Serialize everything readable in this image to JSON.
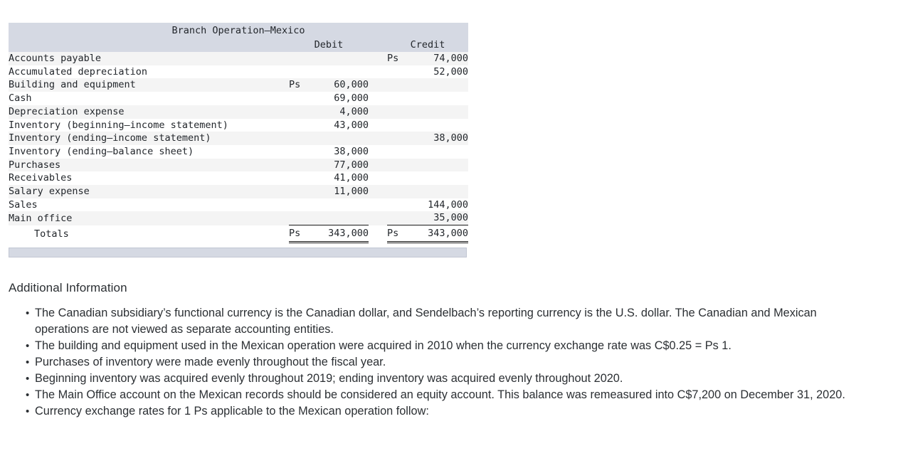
{
  "table": {
    "title": "Branch Operation–Mexico",
    "columns": {
      "account": "",
      "debit": "Debit",
      "credit": "Credit"
    },
    "currency_symbol": "Ps",
    "rows": [
      {
        "account": "Accounts payable",
        "debit_cur": "",
        "debit": "",
        "credit_cur": "Ps",
        "credit": "74,000"
      },
      {
        "account": "Accumulated depreciation",
        "debit_cur": "",
        "debit": "",
        "credit_cur": "",
        "credit": "52,000"
      },
      {
        "account": "Building and equipment",
        "debit_cur": "Ps",
        "debit": "60,000",
        "credit_cur": "",
        "credit": ""
      },
      {
        "account": "Cash",
        "debit_cur": "",
        "debit": "69,000",
        "credit_cur": "",
        "credit": ""
      },
      {
        "account": "Depreciation expense",
        "debit_cur": "",
        "debit": "4,000",
        "credit_cur": "",
        "credit": ""
      },
      {
        "account": "Inventory (beginning–income statement)",
        "debit_cur": "",
        "debit": "43,000",
        "credit_cur": "",
        "credit": ""
      },
      {
        "account": "Inventory (ending–income statement)",
        "debit_cur": "",
        "debit": "",
        "credit_cur": "",
        "credit": "38,000"
      },
      {
        "account": "Inventory (ending–balance sheet)",
        "debit_cur": "",
        "debit": "38,000",
        "credit_cur": "",
        "credit": ""
      },
      {
        "account": "Purchases",
        "debit_cur": "",
        "debit": "77,000",
        "credit_cur": "",
        "credit": ""
      },
      {
        "account": "Receivables",
        "debit_cur": "",
        "debit": "41,000",
        "credit_cur": "",
        "credit": ""
      },
      {
        "account": "Salary expense",
        "debit_cur": "",
        "debit": "11,000",
        "credit_cur": "",
        "credit": ""
      },
      {
        "account": "Sales",
        "debit_cur": "",
        "debit": "",
        "credit_cur": "",
        "credit": "144,000"
      },
      {
        "account": "Main office",
        "debit_cur": "",
        "debit": "",
        "credit_cur": "",
        "credit": "35,000"
      }
    ],
    "totals": {
      "label": "Totals",
      "debit_cur": "Ps",
      "debit": "343,000",
      "credit_cur": "Ps",
      "credit": "343,000"
    }
  },
  "additional": {
    "heading": "Additional Information",
    "notes": [
      "The Canadian subsidiary’s functional currency is the Canadian dollar, and Sendelbach’s reporting currency is the U.S. dollar. The Canadian and Mexican operations are not viewed as separate accounting entities.",
      "The building and equipment used in the Mexican operation were acquired in 2010 when the currency exchange rate was C$0.25 = Ps 1.",
      "Purchases of inventory were made evenly throughout the fiscal year.",
      "Beginning inventory was acquired evenly throughout 2019; ending inventory was acquired evenly throughout 2020.",
      "The Main Office account on the Mexican records should be considered an equity account. This balance was remeasured into C$7,200 on December 31, 2020.",
      "Currency exchange rates for 1 Ps applicable to the Mexican operation follow:"
    ]
  },
  "colors": {
    "header_band": "#d5d9e3",
    "row_shade": "#f4f4f4",
    "row_plain": "#ffffff",
    "text": "#2b2f33"
  }
}
